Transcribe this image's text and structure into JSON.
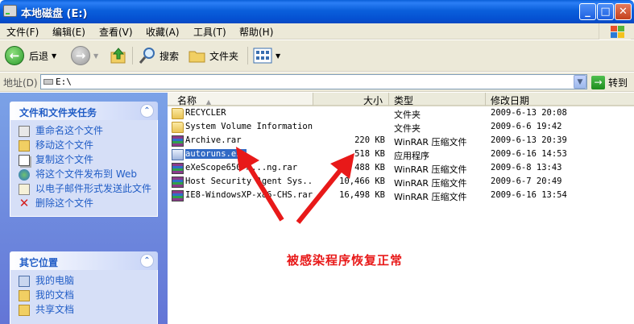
{
  "window": {
    "title": "本地磁盘 (E:)",
    "minimize_glyph": "_",
    "maximize_glyph": "□",
    "close_glyph": "✕"
  },
  "menubar": {
    "items": [
      "文件(F)",
      "编辑(E)",
      "查看(V)",
      "收藏(A)",
      "工具(T)",
      "帮助(H)"
    ]
  },
  "toolbar": {
    "back_label": "后退",
    "search_label": "搜索",
    "folders_label": "文件夹"
  },
  "address": {
    "label": "地址(D)",
    "value": "E:\\",
    "go_label": "转到"
  },
  "tasks_panel": {
    "file_tasks": {
      "title": "文件和文件夹任务",
      "items": [
        {
          "label": "重命名这个文件",
          "icon": "rename-icon"
        },
        {
          "label": "移动这个文件",
          "icon": "move-icon"
        },
        {
          "label": "复制这个文件",
          "icon": "copy-icon"
        },
        {
          "label": "将这个文件发布到 Web",
          "icon": "publish-web-icon"
        },
        {
          "label": "以电子邮件形式发送此文件",
          "icon": "email-icon"
        },
        {
          "label": "删除这个文件",
          "icon": "delete-icon"
        }
      ]
    },
    "other_places": {
      "title": "其它位置",
      "items": [
        {
          "label": "我的电脑",
          "icon": "my-computer-icon"
        },
        {
          "label": "我的文档",
          "icon": "my-documents-icon"
        },
        {
          "label": "共享文档",
          "icon": "shared-documents-icon"
        }
      ]
    }
  },
  "file_list": {
    "columns": {
      "name": "名称",
      "size": "大小",
      "type": "类型",
      "date": "修改日期"
    },
    "files": [
      {
        "name": "RECYCLER",
        "size": "",
        "type": "文件夹",
        "date": "2009-6-13 20:08",
        "icon": "folder-icon"
      },
      {
        "name": "System Volume Information",
        "size": "",
        "type": "文件夹",
        "date": "2009-6-6 19:42",
        "icon": "folder-icon"
      },
      {
        "name": "Archive.rar",
        "size": "220 KB",
        "type": "WinRAR 压缩文件",
        "date": "2009-6-13 20:39",
        "icon": "rar-icon"
      },
      {
        "name": "autoruns.exe",
        "size": "518 KB",
        "type": "应用程序",
        "date": "2009-6-16 14:53",
        "icon": "exe-icon",
        "selected": true
      },
      {
        "name": "eXeScope650-m...ng.rar",
        "size": "488 KB",
        "type": "WinRAR 压缩文件",
        "date": "2009-6-8 13:43",
        "icon": "rar-icon"
      },
      {
        "name": "Host Security Agent Sys...",
        "size": "10,466 KB",
        "type": "WinRAR 压缩文件",
        "date": "2009-6-7 20:49",
        "icon": "rar-icon"
      },
      {
        "name": "IE8-WindowsXP-x86-CHS.rar",
        "size": "16,498 KB",
        "type": "WinRAR 压缩文件",
        "date": "2009-6-16 13:54",
        "icon": "rar-icon"
      }
    ]
  },
  "annotation": {
    "text": "被感染程序恢复正常",
    "color": "#e81919"
  }
}
